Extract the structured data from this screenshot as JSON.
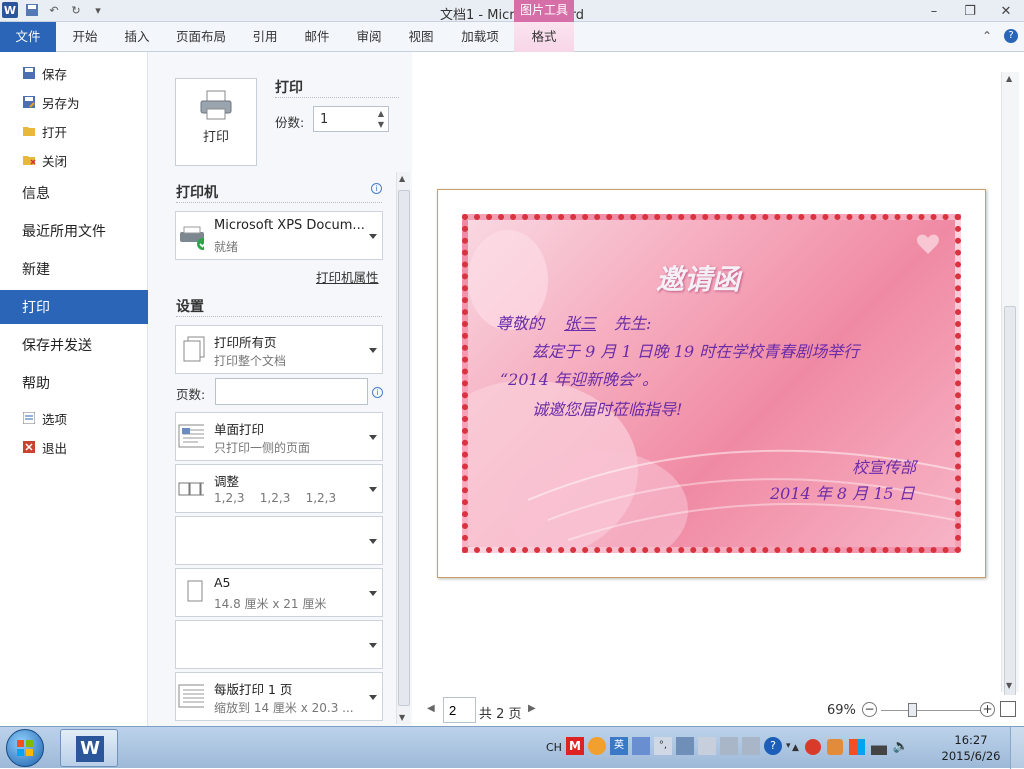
{
  "window": {
    "title": "文档1 - Microsoft Word",
    "contextual_group": "图片工具"
  },
  "ribbon": {
    "tabs": [
      "文件",
      "开始",
      "插入",
      "页面布局",
      "引用",
      "邮件",
      "审阅",
      "视图",
      "加载项",
      "格式"
    ]
  },
  "backstage": {
    "save": "保存",
    "save_as": "另存为",
    "open": "打开",
    "close": "关闭",
    "info": "信息",
    "recent": "最近所用文件",
    "new": "新建",
    "print": "打印",
    "save_send": "保存并发送",
    "help": "帮助",
    "options": "选项",
    "exit": "退出"
  },
  "print_panel": {
    "print_label": "打印",
    "print_button": "打印",
    "copies_label": "份数:",
    "copies_value": "1",
    "printer_header": "打印机",
    "printer_name": "Microsoft XPS Docum...",
    "printer_status": "就绪",
    "printer_props": "打印机属性",
    "settings_header": "设置",
    "range_title": "打印所有页",
    "range_sub": "打印整个文档",
    "pages_label": "页数:",
    "pages_value": "",
    "sides_title": "单面打印",
    "sides_sub": "只打印一侧的页面",
    "collate_title": "调整",
    "collate_sub": "1,2,3    1,2,3    1,2,3",
    "paper_title": "A5",
    "paper_sub": "14.8 厘米 x 21 厘米",
    "perpage_title": "每版打印 1 页",
    "perpage_sub": "缩放到 14 厘米 x 20.3 ..."
  },
  "card": {
    "title": "邀请函",
    "greeting": "尊敬的",
    "name": "张三",
    "honorific": "先生:",
    "line2": "兹定于 9 月 1 日晚 19 时在学校青春剧场举行",
    "line3": "“2014 年迎新晚会”。",
    "line4": "诚邀您届时莅临指导!",
    "signer": "校宣传部",
    "date": "2014 年 8 月 15 日"
  },
  "status": {
    "page_value": "2",
    "page_total": "共 2 页",
    "zoom": "69%"
  },
  "taskbar": {
    "lang": "CH",
    "time": "16:27",
    "date": "2015/6/26"
  },
  "colors": {
    "accent": "#2a65b8",
    "contextual": "#d66fa8",
    "card_text": "#6a2ca8"
  }
}
